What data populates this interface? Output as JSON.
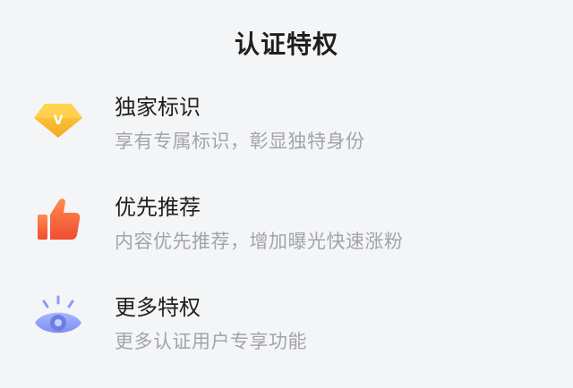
{
  "title": "认证特权",
  "items": [
    {
      "heading": "独家标识",
      "description": "享有专属标识，彰显独特身份",
      "icon": "diamond-v-icon",
      "color": "#f5b828"
    },
    {
      "heading": "优先推荐",
      "description": "内容优先推荐，增加曝光快速涨粉",
      "icon": "thumbs-up-icon",
      "color": "#f2613a"
    },
    {
      "heading": "更多特权",
      "description": "更多认证用户专享功能",
      "icon": "eye-icon",
      "color": "#8a9df2"
    }
  ],
  "colors": {
    "background": "#f4f5f7",
    "title": "#1f1f1f",
    "description": "#a3a4a8"
  }
}
